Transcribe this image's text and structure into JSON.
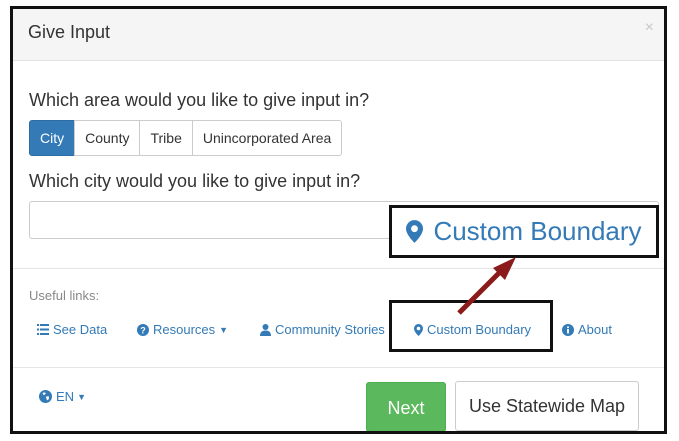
{
  "dialog": {
    "title": "Give Input",
    "close": "×"
  },
  "area_question": "Which area would you like to give input in?",
  "area_options": [
    "City",
    "County",
    "Tribe",
    "Unincorporated Area"
  ],
  "area_selected": "City",
  "city_question": "Which city would you like to give input in?",
  "city_input": {
    "value": "",
    "placeholder": ""
  },
  "useful_links_label": "Useful links:",
  "links": {
    "see_data": "See Data",
    "resources": "Resources",
    "community_stories": "Community Stories",
    "custom_boundary": "Custom Boundary",
    "about": "About"
  },
  "language": "EN",
  "buttons": {
    "next": "Next",
    "statewide_map": "Use Statewide Map"
  },
  "callout": {
    "label": "Custom Boundary",
    "arrow_color": "#8b1a1a"
  },
  "icons": [
    "list-icon",
    "question-circle-icon",
    "user-icon",
    "map-marker-icon",
    "info-circle-icon",
    "globe-icon",
    "caret-down-icon"
  ],
  "colors": {
    "primary": "#337ab7",
    "success": "#5cb85c",
    "arrow": "#8b1a1a"
  }
}
